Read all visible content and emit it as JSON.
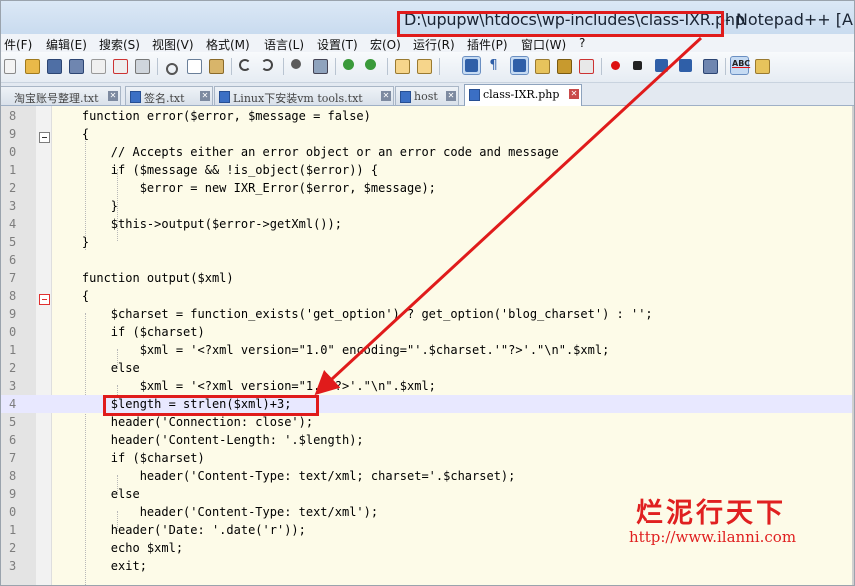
{
  "window": {
    "title_path": "D:\\upupw\\htdocs\\wp-includes\\class-IXR.php",
    "title_app": " - Notepad++ [A"
  },
  "menu": [
    "件(F)",
    "编辑(E)",
    "搜索(S)",
    "视图(V)",
    "格式(M)",
    "语言(L)",
    "设置(T)",
    "宏(O)",
    "运行(R)",
    "插件(P)",
    "窗口(W)",
    "?"
  ],
  "tabs": [
    {
      "label": "淘宝账号整理.txt",
      "active": false
    },
    {
      "label": "签名.txt",
      "active": false
    },
    {
      "label": "Linux下安装vm tools.txt",
      "active": false
    },
    {
      "label": "host",
      "active": false
    },
    {
      "label": "class-IXR.php",
      "active": true
    }
  ],
  "toolbar": {
    "spellcheck_label": "ABC"
  },
  "colors": {
    "annotation_red": "#e01b1b",
    "current_line": "#e8e8ff",
    "keyword_blue": "#0000ff"
  },
  "editor": {
    "lines": [
      {
        "num": "8",
        "code": "    function error($error, $message = false)"
      },
      {
        "num": "9",
        "code": "    {"
      },
      {
        "num": "0",
        "code": "        // Accepts either an error object or an error code and message"
      },
      {
        "num": "1",
        "code": "        if ($message && !is_object($error)) {"
      },
      {
        "num": "2",
        "code": "            $error = new IXR_Error($error, $message);"
      },
      {
        "num": "3",
        "code": "        }"
      },
      {
        "num": "4",
        "code": "        $this->output($error->getXml());"
      },
      {
        "num": "5",
        "code": "    }"
      },
      {
        "num": "6",
        "code": ""
      },
      {
        "num": "7",
        "code": "    function output($xml)"
      },
      {
        "num": "8",
        "code": "    {"
      },
      {
        "num": "9",
        "code": "        $charset = function_exists('get_option') ? get_option('blog_charset') : '';"
      },
      {
        "num": "0",
        "code": "        if ($charset)"
      },
      {
        "num": "1",
        "code": "            $xml = '<?xml version=\"1.0\" encoding=\"'.$charset.'\"?>'.\"\\n\".$xml;"
      },
      {
        "num": "2",
        "code": "        else"
      },
      {
        "num": "3",
        "code": "            $xml = '<?xml version=\"1.0\"?>'.\"\\n\".$xml;"
      },
      {
        "num": "4",
        "code": "        $length = strlen($xml)+3;"
      },
      {
        "num": "5",
        "code": "        header('Connection: close');"
      },
      {
        "num": "6",
        "code": "        header('Content-Length: '.$length);"
      },
      {
        "num": "7",
        "code": "        if ($charset)"
      },
      {
        "num": "8",
        "code": "            header('Content-Type: text/xml; charset='.$charset);"
      },
      {
        "num": "9",
        "code": "        else"
      },
      {
        "num": "0",
        "code": "            header('Content-Type: text/xml');"
      },
      {
        "num": "1",
        "code": "        header('Date: '.date('r'));"
      },
      {
        "num": "2",
        "code": "        echo $xml;"
      },
      {
        "num": "3",
        "code": "        exit;"
      }
    ]
  },
  "watermark": {
    "site_name": "烂泥行天下",
    "url": "http://www.ilanni.com"
  }
}
